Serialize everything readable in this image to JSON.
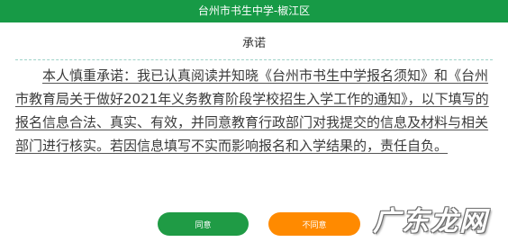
{
  "header": {
    "title": "台州市书生中学-椒江区"
  },
  "main": {
    "section_title": "承诺",
    "commitment_text": "本人慎重承诺：我已认真阅读并知晓《台州市书生中学报名须知》和《台州市教育局关于做好2021年义务教育阶段学校招生入学工作的通知》，以下填写的报名信息合法、真实、有效，并同意教育行政部门对我提交的信息及材料与相关部门进行核实。若因信息填写不实而影响报名和入学结果的，责任自负。"
  },
  "actions": {
    "agree_label": "同意",
    "disagree_label": "不同意"
  },
  "watermark": {
    "text": "广东龙网"
  },
  "colors": {
    "header_bg": "#179a46",
    "agree_bg": "#1f9b45",
    "disagree_bg": "#ff8a00"
  }
}
